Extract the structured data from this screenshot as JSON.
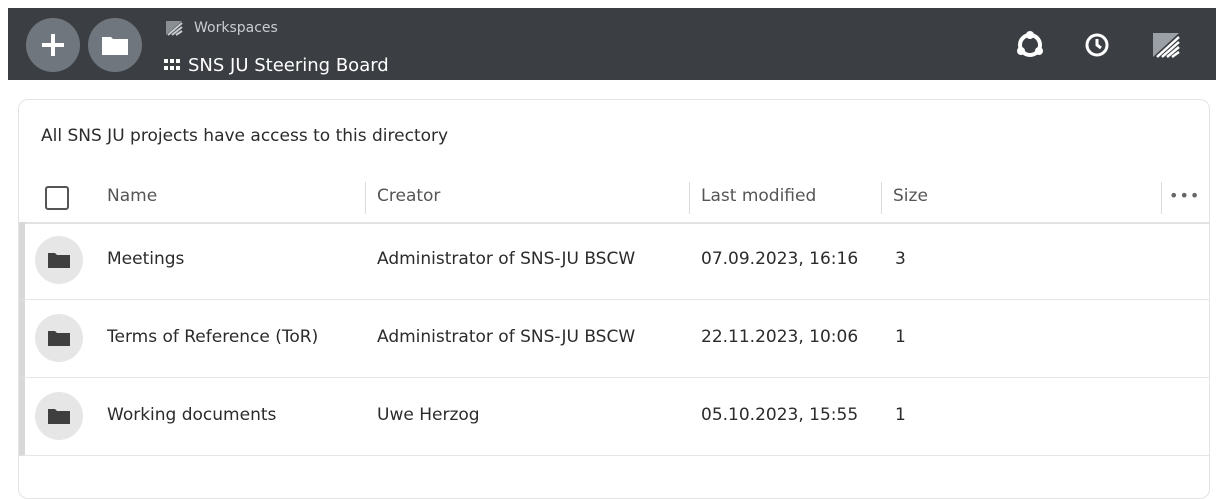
{
  "header": {
    "breadcrumb_parent": "Workspaces",
    "title": "SNS JU Steering Board",
    "icons": [
      "add-icon",
      "folder-icon",
      "workspaces-logo-icon",
      "grid-icon",
      "support-icon",
      "history-icon",
      "bscw-logo-icon"
    ]
  },
  "panel": {
    "description": "All SNS JU projects have access to this directory",
    "columns": {
      "name": "Name",
      "creator": "Creator",
      "last_modified": "Last modified",
      "size": "Size",
      "more": "•••"
    },
    "rows": [
      {
        "name": "Meetings",
        "creator": "Administrator of SNS-JU BSCW",
        "last_modified": "07.09.2023, 16:16",
        "size": "3"
      },
      {
        "name": "Terms of Reference (ToR)",
        "creator": "Administrator of SNS-JU BSCW",
        "last_modified": "22.11.2023, 10:06",
        "size": "1"
      },
      {
        "name": "Working documents",
        "creator": "Uwe Herzog",
        "last_modified": "05.10.2023, 15:55",
        "size": "1"
      }
    ]
  },
  "colors": {
    "topbar": "#3b3f44",
    "button": "#6f767d",
    "folder": "#3f3f3f"
  }
}
